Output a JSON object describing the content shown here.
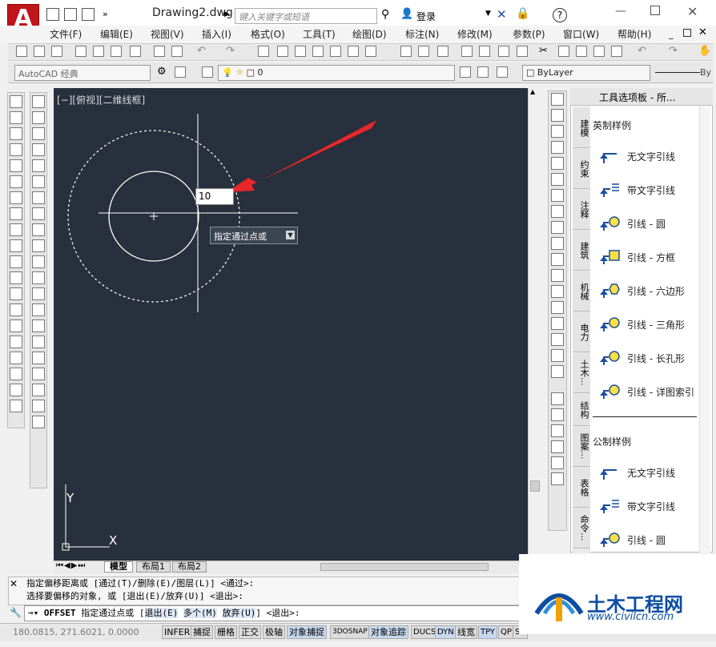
{
  "window": {
    "title": "Drawing2.dwg",
    "search_placeholder": "键入关键字或短语",
    "login": "登录",
    "help": "?"
  },
  "menu": [
    "文件(F)",
    "编辑(E)",
    "视图(V)",
    "插入(I)",
    "格式(O)",
    "工具(T)",
    "绘图(D)",
    "标注(N)",
    "修改(M)",
    "参数(P)",
    "窗口(W)",
    "帮助(H)"
  ],
  "toolbar2": {
    "workspace": "AutoCAD 经典",
    "layer": "0",
    "bylayer": "ByLayer",
    "bylayer2": "By"
  },
  "viewport": {
    "label": "[−][俯视][二维线框]",
    "input_value": "10",
    "tooltip": "指定通过点或",
    "ucs_y": "Y",
    "ucs_x": "X"
  },
  "tabs": [
    "模型",
    "布局1",
    "布局2"
  ],
  "command": {
    "history1": "指定偏移距离或 [通过(T)/删除(E)/图层(L)] <通过>:",
    "history2": "选择要偏移的对象, 或 [退出(E)/放弃(U)] <退出>:",
    "current_cmd": "OFFSET",
    "current_prompt": "指定通过点或 [",
    "opt1": "退出(E)",
    "opt2": "多个(M)",
    "opt3": "放弃(U)",
    "tail": "] <退出>:"
  },
  "status": {
    "coords": "180.0815, 271.6021, 0.0000",
    "buttons": [
      "INFER",
      "捕捉",
      "栅格",
      "正交",
      "极轴",
      "对象捕捉",
      "3DOSNAP",
      "对象追踪",
      "DUCS",
      "DYN",
      "线宽",
      "TPY",
      "QP",
      "SC"
    ]
  },
  "palette": {
    "title": "工具选项板 - 所...",
    "tabs": [
      "建模",
      "约束",
      "注释",
      "建筑",
      "机械",
      "电力",
      "土木...",
      "结构",
      "图案...",
      "表格",
      "命令..."
    ],
    "section1": "英制样例",
    "items1": [
      "无文字引线",
      "带文字引线",
      "引线 - 圆",
      "引线 - 方框",
      "引线 - 六边形",
      "引线 - 三角形",
      "引线 - 长孔形",
      "引线 - 详图索引"
    ],
    "section2": "公制样例",
    "items2": [
      "无文字引线",
      "带文字引线",
      "引线 - 圆"
    ]
  },
  "watermark": {
    "text": "土木工程网",
    "url": "www.civilcn.com"
  },
  "colors": {
    "canvas": "#27303c",
    "accent": "#c0161b",
    "arrow": "#e8272a",
    "brand_blue": "#0b4ea2"
  }
}
